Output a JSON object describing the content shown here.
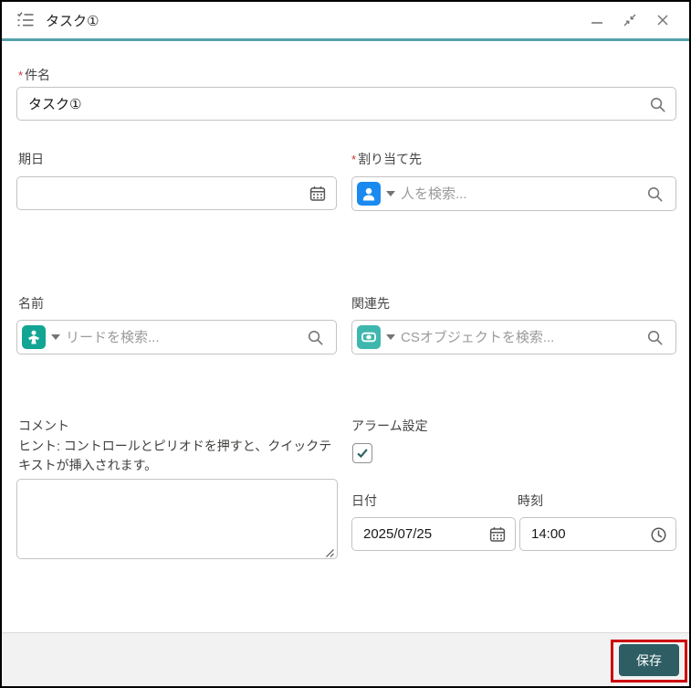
{
  "header": {
    "title": "タスク①"
  },
  "required_marker": "*",
  "form": {
    "subject": {
      "label": "件名",
      "value": "タスク①"
    },
    "due_date": {
      "label": "期日",
      "value": ""
    },
    "assigned_to": {
      "label": "割り当て先",
      "placeholder": "人を検索..."
    },
    "name": {
      "label": "名前",
      "placeholder": "リードを検索..."
    },
    "related_to": {
      "label": "関連先",
      "placeholder": "CSオブジェクトを検索..."
    },
    "comment": {
      "label": "コメント",
      "hint": "ヒント: コントロールとピリオドを押すと、クイックテキストが挿入されます。",
      "value": ""
    },
    "reminder": {
      "label": "アラーム設定",
      "checked": true
    },
    "reminder_date": {
      "label": "日付",
      "value": "2025/07/25"
    },
    "reminder_time": {
      "label": "時刻",
      "value": "14:00"
    }
  },
  "footer": {
    "save_label": "保存"
  },
  "icons": {
    "header": "task-checklist-icon",
    "window": [
      "minimize-icon",
      "restore-icon",
      "close-icon"
    ],
    "fields": [
      "search-icon",
      "calendar-icon",
      "clock-icon",
      "person-icon",
      "lead-icon",
      "custom-object-icon",
      "chevron-down-icon",
      "check-icon",
      "resize-handle-icon"
    ]
  },
  "colors": {
    "accent_teal_divider": "#54a1aa",
    "save_button_teal": "#2e5e63",
    "annotation_red": "#cc0000",
    "assignee_badge_blue": "#1a8af0",
    "lead_badge_teal": "#12a594",
    "object_badge_teal": "#3eb7ae",
    "required_red": "#c23934"
  }
}
